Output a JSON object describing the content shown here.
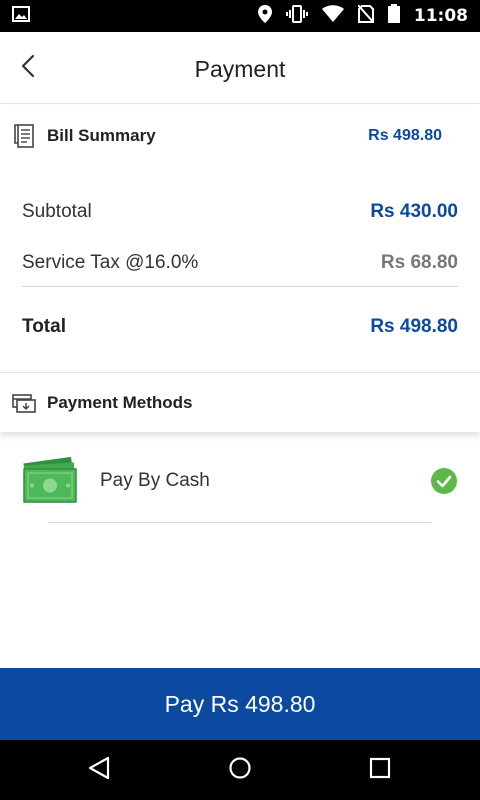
{
  "status_bar": {
    "time": "11:08",
    "icons": [
      "image-icon",
      "location-icon",
      "vibrate-icon",
      "wifi-icon",
      "no-sim-icon",
      "battery-icon"
    ]
  },
  "app_bar": {
    "title": "Payment",
    "back_icon": "back-arrow-icon"
  },
  "bill_summary": {
    "label": "Bill Summary",
    "amount": "Rs 498.80",
    "icon": "receipt-icon",
    "rows": {
      "subtotal": {
        "label": "Subtotal",
        "value": "Rs 430.00"
      },
      "tax": {
        "label": "Service Tax @16.0%",
        "value": "Rs 68.80"
      },
      "total": {
        "label": "Total",
        "value": "Rs 498.80"
      }
    }
  },
  "payment_methods": {
    "label": "Payment Methods",
    "icon": "payment-card-icon",
    "items": [
      {
        "label": "Pay By Cash",
        "icon": "cash-icon",
        "selected": true
      }
    ]
  },
  "pay_button": {
    "label": "Pay Rs 498.80"
  },
  "nav_bar": {
    "icons": [
      "nav-back-icon",
      "nav-home-icon",
      "nav-recents-icon"
    ]
  },
  "colors": {
    "accent": "#0b4aa0",
    "success": "#5cb947",
    "muted": "#777777",
    "cash_green": "#3aa64a"
  }
}
